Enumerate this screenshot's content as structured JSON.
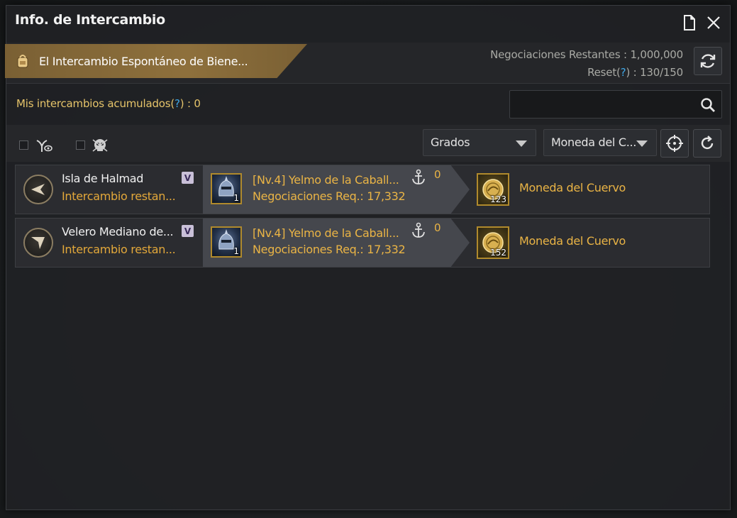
{
  "window": {
    "title": "Info. de Intercambio",
    "doc_icon": "document-icon",
    "close_icon": "close-icon"
  },
  "banner": {
    "label": "El Intercambio Espontáneo de Biene...",
    "icon": "backpack-icon",
    "negotiations_label": "Negociaciones Restantes : 1,000,000",
    "reset_prefix": "Reset(",
    "reset_q": "?",
    "reset_suffix": ") : 130/150",
    "refresh_icon": "refresh-icon"
  },
  "accumulated": {
    "prefix": "Mis intercambios acumulados(",
    "q": "?",
    "suffix": ") : 0"
  },
  "search": {
    "value": "",
    "placeholder": "",
    "icon": "search-icon"
  },
  "filters": {
    "grade_dropdown": "Grados",
    "currency_dropdown": "Moneda del C...",
    "locate_icon": "crosshair-icon",
    "refresh_icon": "refresh-icon",
    "filter1_icon": "ship-eye-icon",
    "filter2_icon": "skull-icon"
  },
  "trades": [
    {
      "location": "Isla de Halmad",
      "sub": "Intercambio restan...",
      "badge": "V",
      "item_name": "[Nv.4] Yelmo de la Caball...",
      "item_req": "Negociaciones Req.: 17,332",
      "item_count": "1",
      "anchor_count": "0",
      "reward_count": "123",
      "reward_name": "Moneda del Cuervo",
      "direction": "left"
    },
    {
      "location": "Velero Mediano de...",
      "sub": "Intercambio restan...",
      "badge": "V",
      "item_name": "[Nv.4] Yelmo de la Caball...",
      "item_req": "Negociaciones Req.: 17,332",
      "item_count": "1",
      "anchor_count": "0",
      "reward_count": "152",
      "reward_name": "Moneda del Cuervo",
      "direction": "down-left"
    }
  ],
  "colors": {
    "accent_gold": "#eab445",
    "orange": "#e3a83a",
    "banner_gold": "#8e703c",
    "question_blue": "#3fa8e8"
  }
}
